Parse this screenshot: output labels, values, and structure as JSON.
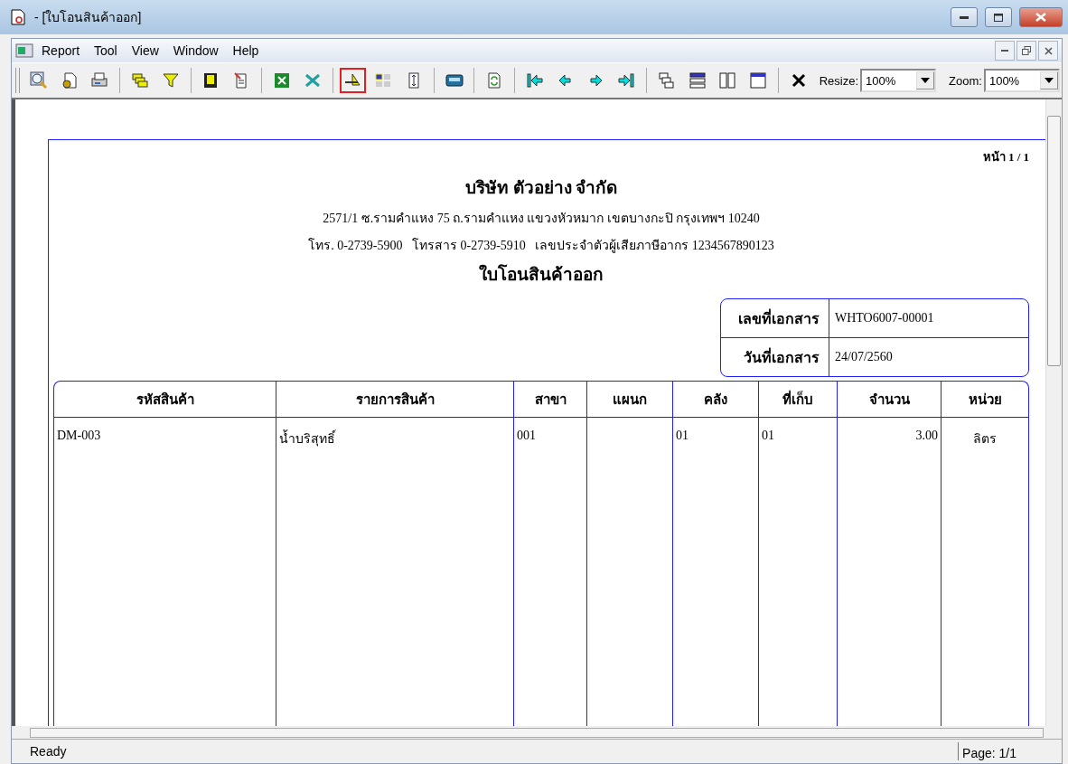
{
  "window": {
    "title": "- [ใบโอนสินค้าออก]"
  },
  "menu": [
    "Report",
    "Tool",
    "View",
    "Window",
    "Help"
  ],
  "toolbar": {
    "groups": [
      [
        {
          "selected": false
        },
        {
          "selected": false
        },
        {
          "selected": false
        }
      ],
      [
        {
          "selected": false
        },
        {
          "selected": false
        }
      ],
      [
        {
          "selected": false
        },
        {
          "selected": false
        }
      ],
      [
        {
          "selected": false
        },
        {
          "selected": false
        }
      ],
      [
        {
          "selected": true
        },
        {
          "selected": false
        },
        {
          "selected": false
        }
      ],
      [
        {
          "selected": false
        }
      ],
      [
        {
          "selected": false
        }
      ],
      [
        {
          "selected": false
        },
        {
          "selected": false
        },
        {
          "selected": false
        },
        {
          "selected": false
        }
      ],
      [
        {
          "selected": false
        },
        {
          "selected": false
        },
        {
          "selected": false
        },
        {
          "selected": false
        }
      ],
      [
        {
          "selected": false
        }
      ]
    ],
    "resize": {
      "label": "Resize:",
      "value": "100%"
    },
    "zoom": {
      "label": "Zoom:",
      "value": "100%"
    }
  },
  "report": {
    "page_number": "หน้า 1 / 1",
    "company": "บริษัท ตัวอย่าง จำกัด",
    "address": "2571/1 ซ.รามคำแหง 75 ถ.รามคำแหง แขวงหัวหมาก เขตบางกะปิ กรุงเทพฯ 10240",
    "contact": "โทร. 0-2739-5900   โทรสาร 0-2739-5910   เลขประจำตัวผู้เสียภาษีอากร 1234567890123",
    "doc_title": "ใบโอนสินค้าออก",
    "doc_info": [
      {
        "label": "เลขที่เอกสาร",
        "value": "WHTO6007-00001"
      },
      {
        "label": "วันที่เอกสาร",
        "value": "24/07/2560"
      }
    ],
    "table": {
      "columns": [
        "รหัสสินค้า",
        "รายการสินค้า",
        "สาขา",
        "แผนก",
        "คลัง",
        "ที่เก็บ",
        "จำนวน",
        "หน่วย"
      ],
      "rows": [
        [
          "DM-003",
          "น้ำบริสุทธิ์",
          "001",
          "",
          "01",
          "01",
          "3.00",
          "ลิตร"
        ]
      ]
    }
  },
  "status_bar": {
    "message": "Ready",
    "page": "Page: 1/1"
  }
}
